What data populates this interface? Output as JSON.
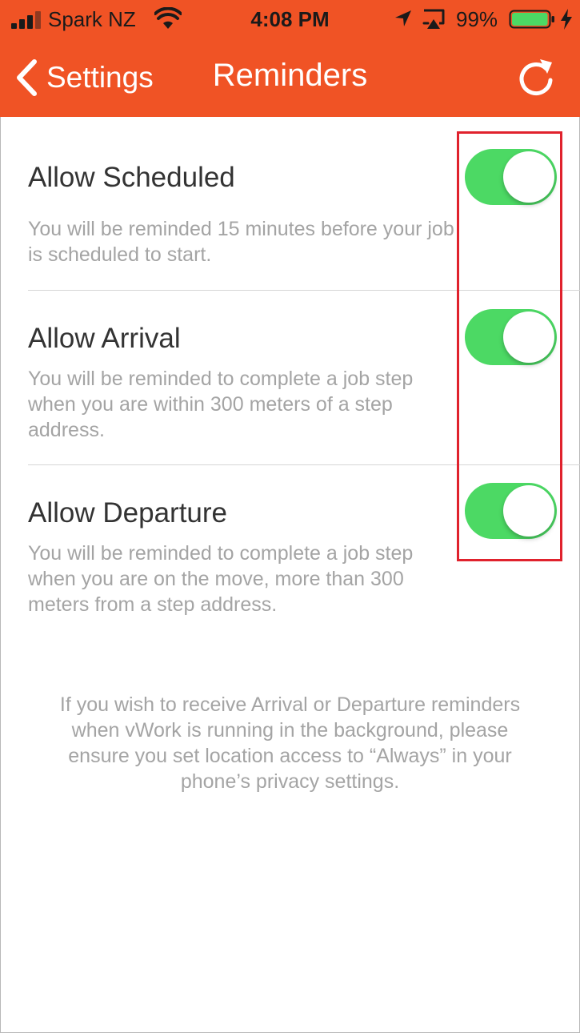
{
  "status_bar": {
    "carrier": "Spark NZ",
    "time": "4:08 PM",
    "battery_percent": "99%",
    "battery_level": 0.99,
    "icons": [
      "signal-bars-icon",
      "wifi-icon",
      "location-arrow-icon",
      "airplay-icon",
      "battery-icon",
      "charging-bolt-icon"
    ]
  },
  "nav": {
    "back_label": "Settings",
    "title": "Reminders",
    "refresh_icon": "refresh-icon"
  },
  "reminders": [
    {
      "title": "Allow Scheduled",
      "description": "You will be reminded 15 minutes before your job is scheduled to start.",
      "enabled": true
    },
    {
      "title": "Allow Arrival",
      "description": "You will be reminded to complete a job step when you are within 300 meters of a step address.",
      "enabled": true
    },
    {
      "title": "Allow Departure",
      "description": "You will be reminded to complete a job step when you are on the move, more than 300 meters from a step address.",
      "enabled": true
    }
  ],
  "footer_note": "If you wish to receive Arrival or Departure reminders when vWork is running in the background, please ensure you set location access to “Always” in your phone’s privacy settings.",
  "colors": {
    "header": "#f05325",
    "toggle_on": "#4cd964",
    "highlight": "#e0222d",
    "description_text": "#a4a4a4",
    "title_text": "#333333"
  }
}
